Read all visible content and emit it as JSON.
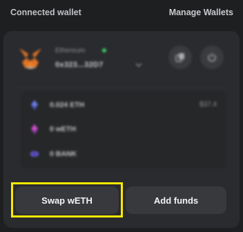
{
  "header": {
    "title": "Connected wallet",
    "manage_label": "Manage Wallets"
  },
  "wallet": {
    "icon": "metamask-fox-icon",
    "network": "Ethereum",
    "status_color": "#3ecf6a",
    "address": "0x323...32D7"
  },
  "assets": [
    {
      "icon": "eth-icon",
      "text": "0.024 ETH",
      "value": "$37.4"
    },
    {
      "icon": "weth-icon",
      "text": "0 wETH",
      "value": ""
    },
    {
      "icon": "bank-icon",
      "text": "0 BANK",
      "value": ""
    }
  ],
  "buttons": {
    "swap_label": "Swap wETH",
    "add_label": "Add funds"
  },
  "colors": {
    "highlight": "#ffe900",
    "background": "#1e1f21",
    "card": "#2a2b2e"
  }
}
